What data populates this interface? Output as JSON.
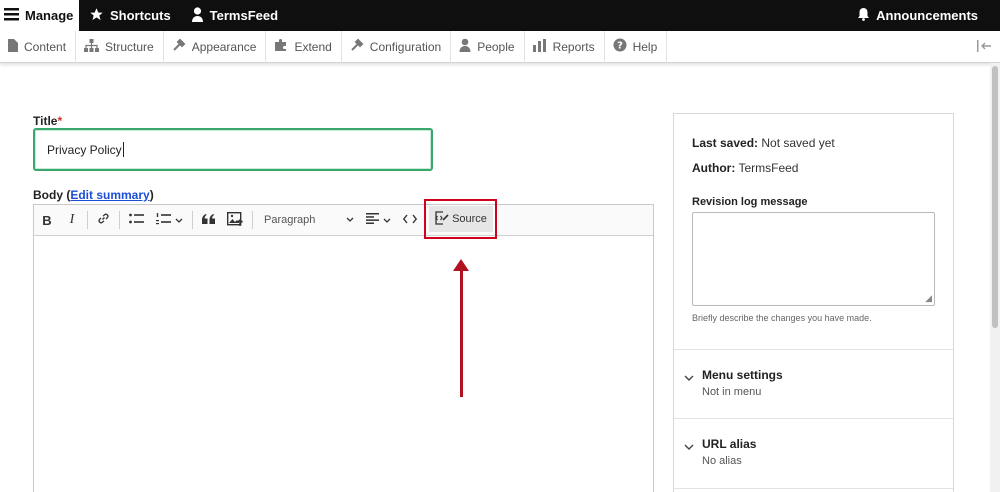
{
  "topbar": {
    "manage": "Manage",
    "shortcuts": "Shortcuts",
    "user": "TermsFeed",
    "announcements": "Announcements"
  },
  "admin_menu": [
    {
      "label": "Content",
      "icon": "file-icon"
    },
    {
      "label": "Structure",
      "icon": "sitemap-icon"
    },
    {
      "label": "Appearance",
      "icon": "wrench-icon"
    },
    {
      "label": "Extend",
      "icon": "puzzle-icon"
    },
    {
      "label": "Configuration",
      "icon": "wrench-icon"
    },
    {
      "label": "People",
      "icon": "person-icon"
    },
    {
      "label": "Reports",
      "icon": "bar-chart-icon"
    },
    {
      "label": "Help",
      "icon": "question-icon"
    }
  ],
  "form": {
    "title_label": "Title",
    "required_mark": "*",
    "title_value": "Privacy Policy",
    "body_label": "Body",
    "edit_summary": "Edit summary",
    "paren_open": "(",
    "paren_close": ")"
  },
  "toolbar": {
    "bold": "B",
    "italic": "I",
    "paragraph": "Paragraph",
    "source": "Source"
  },
  "sidebar": {
    "last_saved_label": "Last saved:",
    "last_saved_value": "Not saved yet",
    "author_label": "Author:",
    "author_value": "TermsFeed",
    "revision_label": "Revision log message",
    "revision_hint": "Briefly describe the changes you have made.",
    "menu_settings": "Menu settings",
    "menu_settings_value": "Not in menu",
    "url_alias": "URL alias",
    "url_alias_value": "No alias"
  },
  "colors": {
    "highlight": "#d0021b",
    "arrow": "#b0121f",
    "focus": "#3aa76d"
  }
}
